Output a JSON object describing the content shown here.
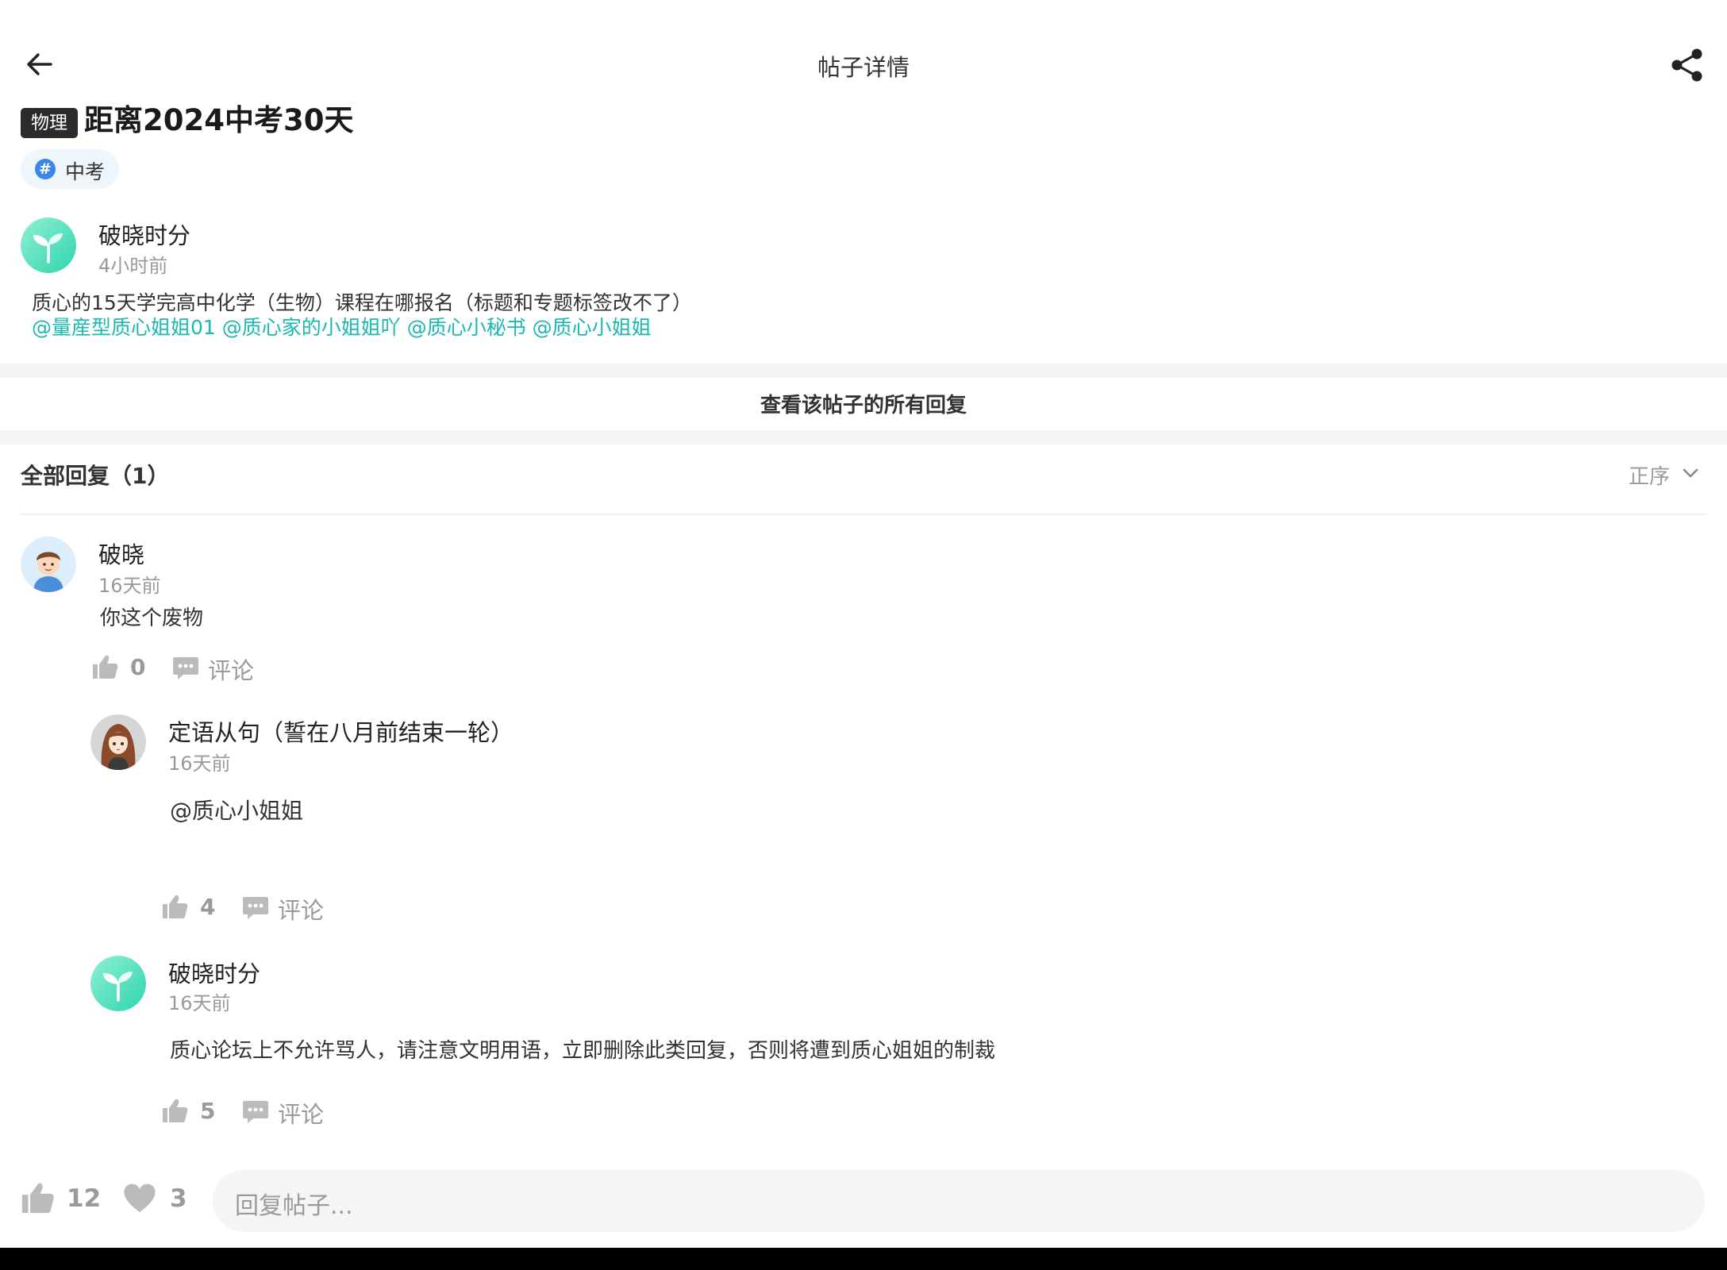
{
  "header": {
    "title": "帖子详情",
    "back_icon": "back-arrow-icon",
    "share_icon": "share-icon"
  },
  "post": {
    "subject_tag": "物理",
    "title": "距离2024中考30天",
    "topic": "中考",
    "author": {
      "name": "破晓时分",
      "time": "4小时前",
      "avatar_icon": "sprout-avatar"
    },
    "body": "质心的15天学完高中化学（生物）课程在哪报名（标题和专题标签改不了）",
    "mentions": "@量産型质心姐姐01 @质心家的小姐姐吖 @质心小秘书 @质心小姐姐"
  },
  "view_all_label": "查看该帖子的所有回复",
  "replies_header": {
    "title": "全部回复（1）",
    "sort_label": "正序"
  },
  "comments": [
    {
      "name": "破晓",
      "time": "16天前",
      "text": "你这个废物",
      "likes": "0",
      "comment_label": "评论"
    }
  ],
  "sub_comments": [
    {
      "name": "定语从句（誓在八月前结束一轮）",
      "time": "16天前",
      "text": "@质心小姐姐",
      "likes": "4",
      "comment_label": "评论"
    },
    {
      "name": "破晓时分",
      "time": "16天前",
      "text": "质心论坛上不允许骂人，请注意文明用语，立即删除此类回复，否则将遭到质心姐姐的制裁",
      "likes": "5",
      "comment_label": "评论"
    }
  ],
  "bottom_bar": {
    "likes": "12",
    "favorites": "3",
    "reply_placeholder": "回复帖子..."
  },
  "colors": {
    "accent": "#19b8b0",
    "tag_bg": "#2b2b2b",
    "topic_hash": "#3b86e8",
    "divider": "#f4f5f6"
  }
}
